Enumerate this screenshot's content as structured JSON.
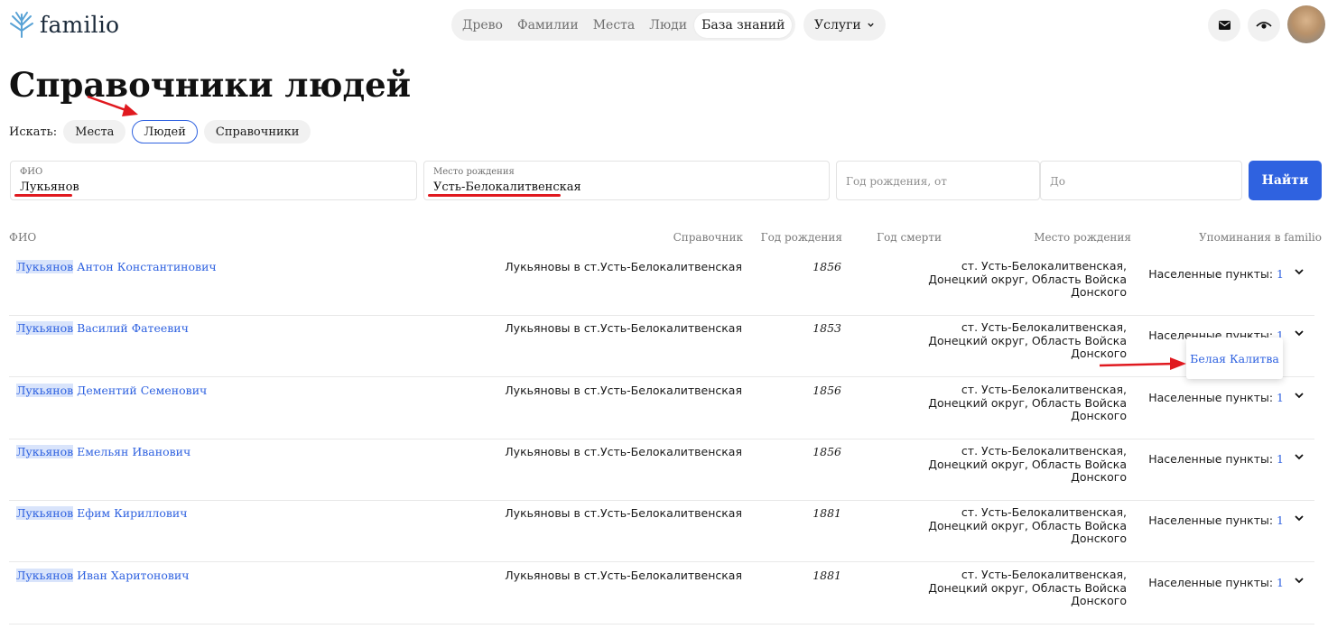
{
  "header": {
    "logo_text": "familio",
    "logo_icon": "tree-logo-icon",
    "nav": [
      {
        "label": "Древо",
        "active": false
      },
      {
        "label": "Фамилии",
        "active": false
      },
      {
        "label": "Места",
        "active": false
      },
      {
        "label": "Люди",
        "active": false
      },
      {
        "label": "База знаний",
        "active": true
      }
    ],
    "services_label": "Услуги",
    "icons": [
      "mail-icon",
      "eye-icon"
    ],
    "accent_color": "#2f62e0"
  },
  "page": {
    "title": "Справочники людей",
    "search_label": "Искать:",
    "search_options": [
      {
        "label": "Места",
        "selected": false
      },
      {
        "label": "Людей",
        "selected": true
      },
      {
        "label": "Справочники",
        "selected": false
      }
    ]
  },
  "filters": {
    "fio": {
      "label": "ФИО",
      "value": "Лукьянов"
    },
    "birthplace": {
      "label": "Место рождения",
      "value": "Усть-Белокалитвенская"
    },
    "year_from": {
      "placeholder": "Год рождения, от"
    },
    "year_to": {
      "placeholder": "До"
    },
    "submit_label": "Найти"
  },
  "table": {
    "headers": {
      "fio": "ФИО",
      "reference": "Справочник",
      "birth_year": "Год рождения",
      "death_year": "Год смерти",
      "birthplace": "Место рождения",
      "mentions": "Упоминания в familio"
    },
    "rows": [
      {
        "surname": "Лукьянов",
        "rest": " Антон Константинович",
        "reference": "Лукьяновы в ст.Усть-Белокалитвенская",
        "birth_year": "1856",
        "death_year": "",
        "place": "ст. Усть-Белокалитвенская, Донецкий округ, Область Войска Донского",
        "mentions_label": "Населенные пункты:",
        "mentions_count": "1"
      },
      {
        "surname": "Лукьянов",
        "rest": " Василий Фатеевич",
        "reference": "Лукьяновы в ст.Усть-Белокалитвенская",
        "birth_year": "1853",
        "death_year": "",
        "place": "ст. Усть-Белокалитвенская, Донецкий округ, Область Войска Донского",
        "mentions_label": "Населенные пункты:",
        "mentions_count": "1"
      },
      {
        "surname": "Лукьянов",
        "rest": " Дементий Семенович",
        "reference": "Лукьяновы в ст.Усть-Белокалитвенская",
        "birth_year": "1856",
        "death_year": "",
        "place": "ст. Усть-Белокалитвенская, Донецкий округ, Область Войска Донского",
        "mentions_label": "Населенные пункты:",
        "mentions_count": "1"
      },
      {
        "surname": "Лукьянов",
        "rest": " Емельян Иванович",
        "reference": "Лукьяновы в ст.Усть-Белокалитвенская",
        "birth_year": "1856",
        "death_year": "",
        "place": "ст. Усть-Белокалитвенская, Донецкий округ, Область Войска Донского",
        "mentions_label": "Населенные пункты:",
        "mentions_count": "1"
      },
      {
        "surname": "Лукьянов",
        "rest": " Ефим Кириллович",
        "reference": "Лукьяновы в ст.Усть-Белокалитвенская",
        "birth_year": "1881",
        "death_year": "",
        "place": "ст. Усть-Белокалитвенская, Донецкий округ, Область Войска Донского",
        "mentions_label": "Населенные пункты:",
        "mentions_count": "1"
      },
      {
        "surname": "Лукьянов",
        "rest": " Иван Харитонович",
        "reference": "Лукьяновы в ст.Усть-Белокалитвенская",
        "birth_year": "1881",
        "death_year": "",
        "place": "ст. Усть-Белокалитвенская, Донецкий округ, Область Войска Донского",
        "mentions_label": "Населенные пункты:",
        "mentions_count": "1"
      }
    ],
    "dropdown_item": "Белая Калитва"
  }
}
